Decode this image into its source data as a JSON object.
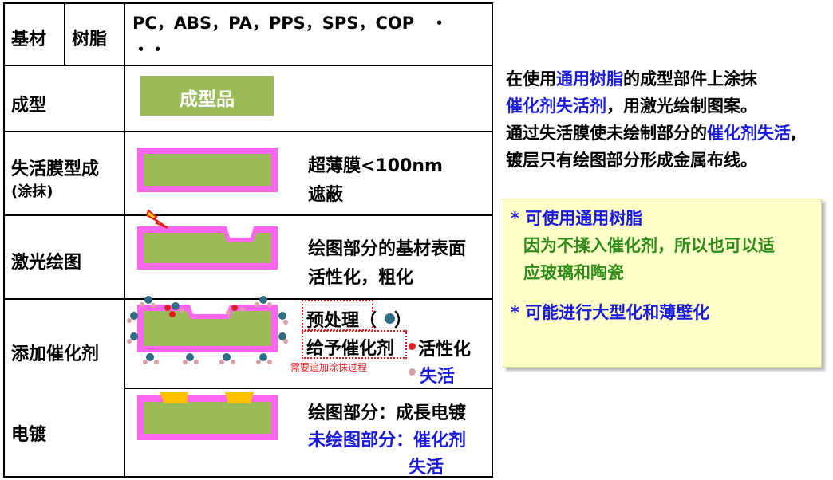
{
  "table": {
    "row_substrate": {
      "label": "基材",
      "sub_label": "树脂",
      "materials_line1": "PC，ABS，PA，PPS，SPS，COP　・",
      "materials_line2": "・・"
    },
    "row_molding": {
      "label": "成型",
      "part_label": "成型品"
    },
    "row_deactivation": {
      "label": "失活膜型成",
      "sub_label": "(涂抹)",
      "desc_line1": "超薄膜<100nm",
      "desc_line2": "遮蔽"
    },
    "row_laser": {
      "label": "激光绘图",
      "desc_line1": "绘图部分的基材表面",
      "desc_line2": "活性化，粗化"
    },
    "row_catalyst": {
      "label": "添加催化剂",
      "pretreat_label": "预处理（",
      "pretreat_close": "）",
      "catalyst_label": "给予催化剂",
      "active_label": "活性化",
      "inactive_label": "失活",
      "note": "需要追加涂抹过程"
    },
    "row_plating": {
      "label": "电镀",
      "desc_line1": "绘图部分：成長电镀",
      "desc_line2": "未绘图部分：催化剂",
      "desc_line3": "失活"
    }
  },
  "explanation": {
    "seg1": "在使用",
    "seg2": "通用树脂",
    "seg3": "的成型部件上涂抹",
    "seg4": "催化剂失活剂",
    "seg5": "，用激光绘制图案。",
    "seg6": "通过失活膜使未绘制部分的",
    "seg7": "催化剂失活",
    "seg8": ",",
    "seg9": "镀层只有绘图部分形成金属布线。"
  },
  "notes": {
    "point1_title": "* 可使用通用树脂",
    "point1_line1": "因为不揉入催化剂，所以也可以适",
    "point1_line2": "应玻璃和陶瓷",
    "point2_title": "* 可能进行大型化和薄壁化"
  },
  "colors": {
    "resin_green": "#9bbb59",
    "deactivation_film": "#ff66ee",
    "plating_gold": "#ffc000",
    "highlight_blue": "#1a1adc",
    "note_green": "#2e8b1a",
    "note_bg": "#ffffc8"
  }
}
